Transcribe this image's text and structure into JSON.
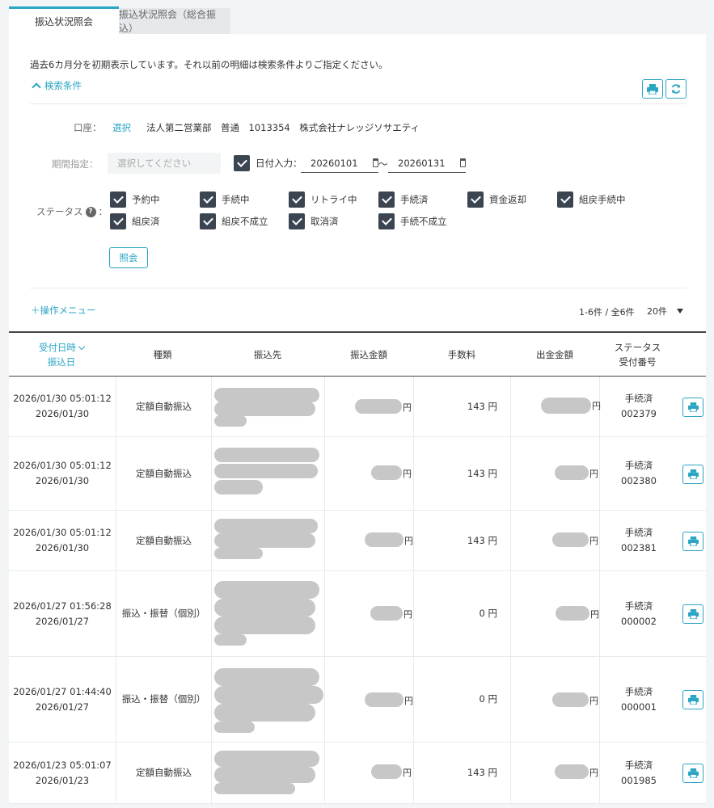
{
  "tabs": [
    {
      "label": "振込状況照会"
    },
    {
      "label": "振込状況照会（総合振込）"
    }
  ],
  "notice": "過去6カ月分を初期表示しています。それ以前の明細は検索条件よりご指定ください。",
  "search": {
    "toggle_label": "検索条件",
    "account_label": "口座：",
    "select_link": "選択",
    "account_value": "法人第二営業部　普通　1013354　株式会社ナレッジソサエティ",
    "period_label": "期間指定：",
    "period_placeholder": "選択してください",
    "date_input_label": "日付入力：",
    "date_from": "20260101",
    "tilde": "〜",
    "date_to": "20260131",
    "status_label": "ステータス",
    "statuses": [
      "予約中",
      "手続中",
      "リトライ中",
      "手続済",
      "資金返却",
      "組戻手続中",
      "組戻済",
      "組戻不成立",
      "取消済",
      "手続不成立"
    ],
    "query_button": "照会"
  },
  "toolbar": {
    "ops_menu": "＋操作メニュー",
    "count": "1-6件 / 全6件",
    "per_page": "20件"
  },
  "table": {
    "headers": {
      "received": "受付日時",
      "transfer_date": "振込日",
      "type": "種類",
      "payee": "振込先",
      "amount": "振込金額",
      "fee": "手数料",
      "withdrawal": "出金金額",
      "status": "ステータス",
      "receipt_no": "受付番号"
    },
    "yen": "円",
    "rows": [
      {
        "received": "2026/01/30 05:01:12",
        "date": "2026/01/30",
        "type": "定額自動振込",
        "fee": "143 円",
        "status": "手続済",
        "no": "002379"
      },
      {
        "received": "2026/01/30 05:01:12",
        "date": "2026/01/30",
        "type": "定額自動振込",
        "fee": "143 円",
        "status": "手続済",
        "no": "002380"
      },
      {
        "received": "2026/01/30 05:01:12",
        "date": "2026/01/30",
        "type": "定額自動振込",
        "fee": "143 円",
        "status": "手続済",
        "no": "002381"
      },
      {
        "received": "2026/01/27 01:56:28",
        "date": "2026/01/27",
        "type": "振込・振替（個別）",
        "fee": "0 円",
        "status": "手続済",
        "no": "000002"
      },
      {
        "received": "2026/01/27 01:44:40",
        "date": "2026/01/27",
        "type": "振込・振替（個別）",
        "fee": "0 円",
        "status": "手続済",
        "no": "000001"
      },
      {
        "received": "2026/01/23 05:01:07",
        "date": "2026/01/23",
        "type": "定額自動振込",
        "fee": "143 円",
        "status": "手続済",
        "no": "001985"
      }
    ]
  },
  "colors": {
    "accent": "#2aa5c4",
    "checkbox": "#3b4552",
    "redaction": "#c7c7c7"
  }
}
